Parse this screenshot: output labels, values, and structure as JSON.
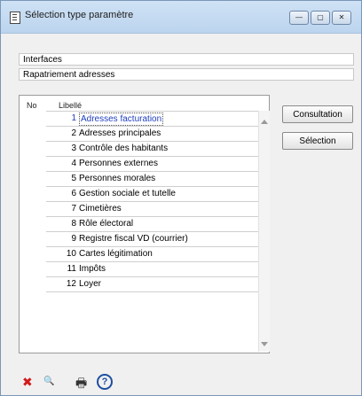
{
  "window": {
    "title": "Sélection type paramètre",
    "controls": {
      "minimize": "—",
      "maximize": "▢",
      "close": "✕"
    }
  },
  "fields": {
    "field1": "Interfaces",
    "field2": "Rapatriement adresses"
  },
  "list": {
    "headers": {
      "no": "No",
      "label": "Libellé"
    },
    "selected_index": 0,
    "rows": [
      {
        "no": "1",
        "label": "Adresses facturation"
      },
      {
        "no": "2",
        "label": "Adresses principales"
      },
      {
        "no": "3",
        "label": "Contrôle des habitants"
      },
      {
        "no": "4",
        "label": "Personnes externes"
      },
      {
        "no": "5",
        "label": "Personnes morales"
      },
      {
        "no": "6",
        "label": "Gestion sociale et tutelle"
      },
      {
        "no": "7",
        "label": "Cimetières"
      },
      {
        "no": "8",
        "label": "Rôle électoral"
      },
      {
        "no": "9",
        "label": "Registre fiscal VD (courrier)"
      },
      {
        "no": "10",
        "label": "Cartes légitimation"
      },
      {
        "no": "11",
        "label": "Impôts"
      },
      {
        "no": "12",
        "label": "Loyer"
      }
    ]
  },
  "buttons": {
    "consultation": "Consultation",
    "selection": "Sélection"
  },
  "icons": {
    "delete": {
      "name": "delete-x-icon",
      "glyph": "✖",
      "color": "#d11a1a"
    },
    "search": {
      "name": "magnifier-icon",
      "glyph": "🔍",
      "color": "#444444"
    },
    "print": {
      "name": "printer-icon",
      "glyph": "🖶",
      "color": "#333333"
    },
    "help": {
      "name": "help-icon",
      "glyph": "?",
      "color": "#1d4fa0"
    }
  }
}
